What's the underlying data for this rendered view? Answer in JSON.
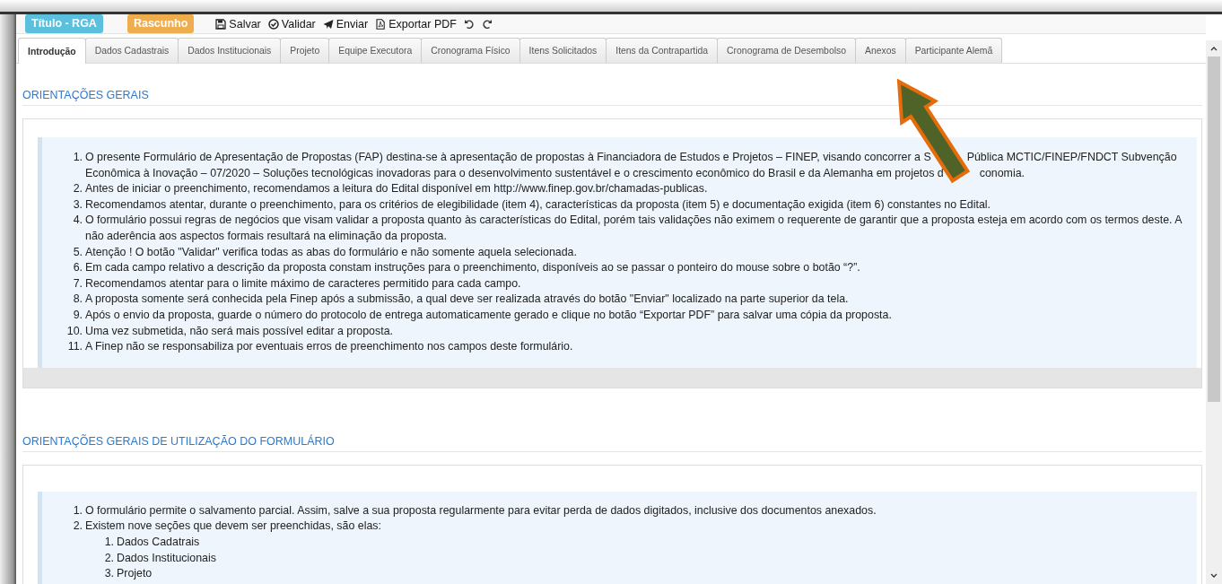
{
  "toolbar": {
    "title_badge": "Título - RGA",
    "status_badge": "Rascunho",
    "actions": [
      {
        "kind": "save",
        "label": "Salvar"
      },
      {
        "kind": "validate",
        "label": "Validar"
      },
      {
        "kind": "send",
        "label": "Enviar"
      },
      {
        "kind": "pdf",
        "label": "Exportar PDF"
      },
      {
        "kind": "undo"
      },
      {
        "kind": "redo"
      }
    ]
  },
  "tabs": [
    {
      "label": "Introdução",
      "selected": true
    },
    {
      "label": "Dados Cadastrais",
      "selected": false
    },
    {
      "label": "Dados Institucionais",
      "selected": false
    },
    {
      "label": "Projeto",
      "selected": false
    },
    {
      "label": "Equipe Executora",
      "selected": false
    },
    {
      "label": "Cronograma Físico",
      "selected": false
    },
    {
      "label": "Itens Solicitados",
      "selected": false
    },
    {
      "label": "Itens da Contrapartida",
      "selected": false
    },
    {
      "label": "Cronograma de Desembolso",
      "selected": false
    },
    {
      "label": "Anexos",
      "selected": false
    },
    {
      "label": "Participante Alemã",
      "selected": false
    }
  ],
  "sections": [
    {
      "heading": "ORIENTAÇÕES GERAIS",
      "footer": true,
      "items": [
        {
          "number": "1.",
          "lines": [
            [
              {
                "kind": "text",
                "text": "O presente Formulário de Apresentação de Propostas (FAP) destina-se à apresentação de propostas à Financiadora de Estudos e Projetos – FINEP, visando concorrer a S"
              },
              {
                "kind": "gap"
              },
              {
                "kind": "text",
                "text": "Pública MCTIC/FINEP/FNDCT Subvenção"
              }
            ],
            [
              {
                "kind": "text",
                "text": "Econômica à Inovação – 07/2020 – Soluções tecnológicas inovadoras para o desenvolvimento sustentável e o crescimento econômico do Brasil e da Alemanha em projetos d"
              },
              {
                "kind": "gap"
              },
              {
                "kind": "text",
                "text": "conomia."
              }
            ]
          ]
        },
        {
          "number": "2.",
          "text": "Antes de iniciar o preenchimento, recomendamos a leitura do Edital disponível em http://www.finep.gov.br/chamadas-publicas."
        },
        {
          "number": "3.",
          "text": "Recomendamos atentar, durante o preenchimento, para os critérios de elegibilidade (item 4), características da proposta (item 5) e documentação exigida (item 6) constantes no Edital."
        },
        {
          "number": "4.",
          "text": "O formulário possui regras de negócios que visam validar a proposta quanto às características do Edital, porém tais validações não eximem o requerente de garantir que a proposta esteja em acordo com os termos deste. A não aderência aos aspectos formais resultará na eliminação da proposta."
        },
        {
          "number": "5.",
          "text": "Atenção ! O botão \"Validar\" verifica todas as abas do formulário e não somente aquela selecionada."
        },
        {
          "number": "6.",
          "text": "Em cada campo relativo a descrição da proposta constam instruções para o preenchimento, disponíveis ao se passar o ponteiro do mouse sobre o botão “?”."
        },
        {
          "number": "7.",
          "text": "Recomendamos atentar para o limite máximo de caracteres permitido para cada campo."
        },
        {
          "number": "8.",
          "text": "A proposta somente será conhecida pela Finep após a submissão, a qual deve ser realizada através do botão \"Enviar\" localizado na parte superior da tela."
        },
        {
          "number": "9.",
          "text": "Após o envio da proposta, guarde o número do protocolo de entrega automaticamente gerado e clique no botão “Exportar PDF” para salvar uma cópia da proposta."
        },
        {
          "number": "10.",
          "text": "Uma vez submetida, não será mais possível editar a proposta."
        },
        {
          "number": "11.",
          "text": "A Finep não se responsabiliza por eventuais erros de preenchimento nos campos deste formulário."
        }
      ]
    },
    {
      "heading": "ORIENTAÇÕES GERAIS DE UTILIZAÇÃO DO FORMULÁRIO",
      "footer": false,
      "items": [
        {
          "number": "1.",
          "text": "O formulário permite o salvamento parcial. Assim, salve a sua proposta regularmente para evitar perda de dados digitados, inclusive dos documentos anexados."
        },
        {
          "number": "2.",
          "text": "Existem nove seções que devem ser preenchidas, são elas:",
          "children": [
            {
              "number": "1.",
              "text": "Dados Cadatrais"
            },
            {
              "number": "2.",
              "text": "Dados Institucionais"
            },
            {
              "number": "3.",
              "text": "Projeto"
            }
          ]
        }
      ]
    }
  ]
}
